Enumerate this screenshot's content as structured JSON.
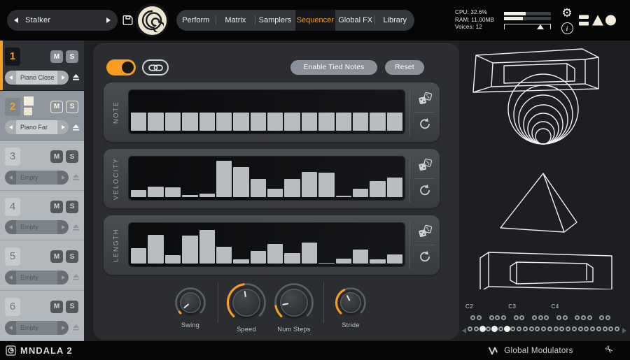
{
  "header": {
    "preset_name": "Stalker",
    "tabs": [
      {
        "label": "Perform",
        "active": false
      },
      {
        "label": "Matrix",
        "active": false
      },
      {
        "label": "Samplers",
        "active": false
      },
      {
        "label": "Sequencer",
        "active": true
      },
      {
        "label": "Global FX",
        "active": false
      },
      {
        "label": "Library",
        "active": false
      }
    ],
    "stats": {
      "cpu": "CPU: 32.6%",
      "ram": "RAM: 11.00MB",
      "voices": "Voices: 12"
    },
    "meters": {
      "values_pct": [
        47,
        41
      ],
      "slider_pct": 79
    }
  },
  "sidebar": {
    "slots": [
      {
        "number": "1",
        "mute": "M",
        "solo": "S",
        "preset": "Piano Close",
        "state": "active"
      },
      {
        "number": "2",
        "mute": "M",
        "solo": "S",
        "preset": "Piano Far",
        "state": "selected",
        "layer_squares": 2
      },
      {
        "number": "3",
        "mute": "M",
        "solo": "S",
        "preset": "Empty",
        "state": "empty"
      },
      {
        "number": "4",
        "mute": "M",
        "solo": "S",
        "preset": "Empty",
        "state": "empty"
      },
      {
        "number": "5",
        "mute": "M",
        "solo": "S",
        "preset": "Empty",
        "state": "empty"
      },
      {
        "number": "6",
        "mute": "M",
        "solo": "S",
        "preset": "Empty",
        "state": "empty"
      }
    ]
  },
  "sequencer": {
    "power_on": true,
    "buttons": {
      "enable_tied_notes": "Enable Tied Notes",
      "reset": "Reset"
    },
    "lanes": [
      {
        "label": "NOTE",
        "values_pct": [
          45,
          45,
          45,
          45,
          45,
          45,
          45,
          45,
          45,
          45,
          45,
          45,
          45,
          45,
          45,
          45
        ]
      },
      {
        "label": "VELOCITY",
        "values_pct": [
          17,
          27,
          25,
          5,
          8,
          92,
          75,
          46,
          21,
          46,
          63,
          62,
          3,
          21,
          41,
          49
        ]
      },
      {
        "label": "LENGTH",
        "values_pct": [
          38,
          72,
          21,
          70,
          85,
          42,
          11,
          32,
          50,
          27,
          52,
          2,
          13,
          35,
          11,
          23
        ]
      }
    ],
    "knobs": [
      {
        "label": "Swing",
        "value": 0.02,
        "size": "small"
      },
      {
        "label": "Speed",
        "value": 0.47,
        "size": "large"
      },
      {
        "label": "Num Steps",
        "value": 0.13,
        "size": "large"
      },
      {
        "label": "Stride",
        "value": 0.4,
        "size": "small"
      }
    ]
  },
  "right_panel": {
    "octave_labels": [
      "C2",
      "C3",
      "C4"
    ],
    "keyboard": {
      "white_count": 25,
      "highlighted": [
        2,
        4,
        6
      ],
      "black_offsets": [
        0.5,
        1.5,
        3.5,
        4.5,
        5.5
      ],
      "octaves": 4
    }
  },
  "footer": {
    "brand": "MNDALA 2",
    "right_label": "Global Modulators"
  },
  "icons": {
    "prev_preset": "left-arrow",
    "next_preset": "right-arrow",
    "save": "floppy-disk",
    "app_logo": "spiral",
    "settings": "gear",
    "about": "info-circle",
    "company_mark": "bars-triangle-circle",
    "link": "chain-link",
    "randomize": "dice",
    "reset_lane": "rotate-arrow",
    "eject": "eject",
    "footer_tool": "scissors",
    "modulator_mark": "wave-glyph"
  },
  "colors": {
    "accent": "#f79d20",
    "cream": "#ece5d0",
    "bar": "#b9bdc1",
    "active_tab_text": "#f59b24"
  }
}
